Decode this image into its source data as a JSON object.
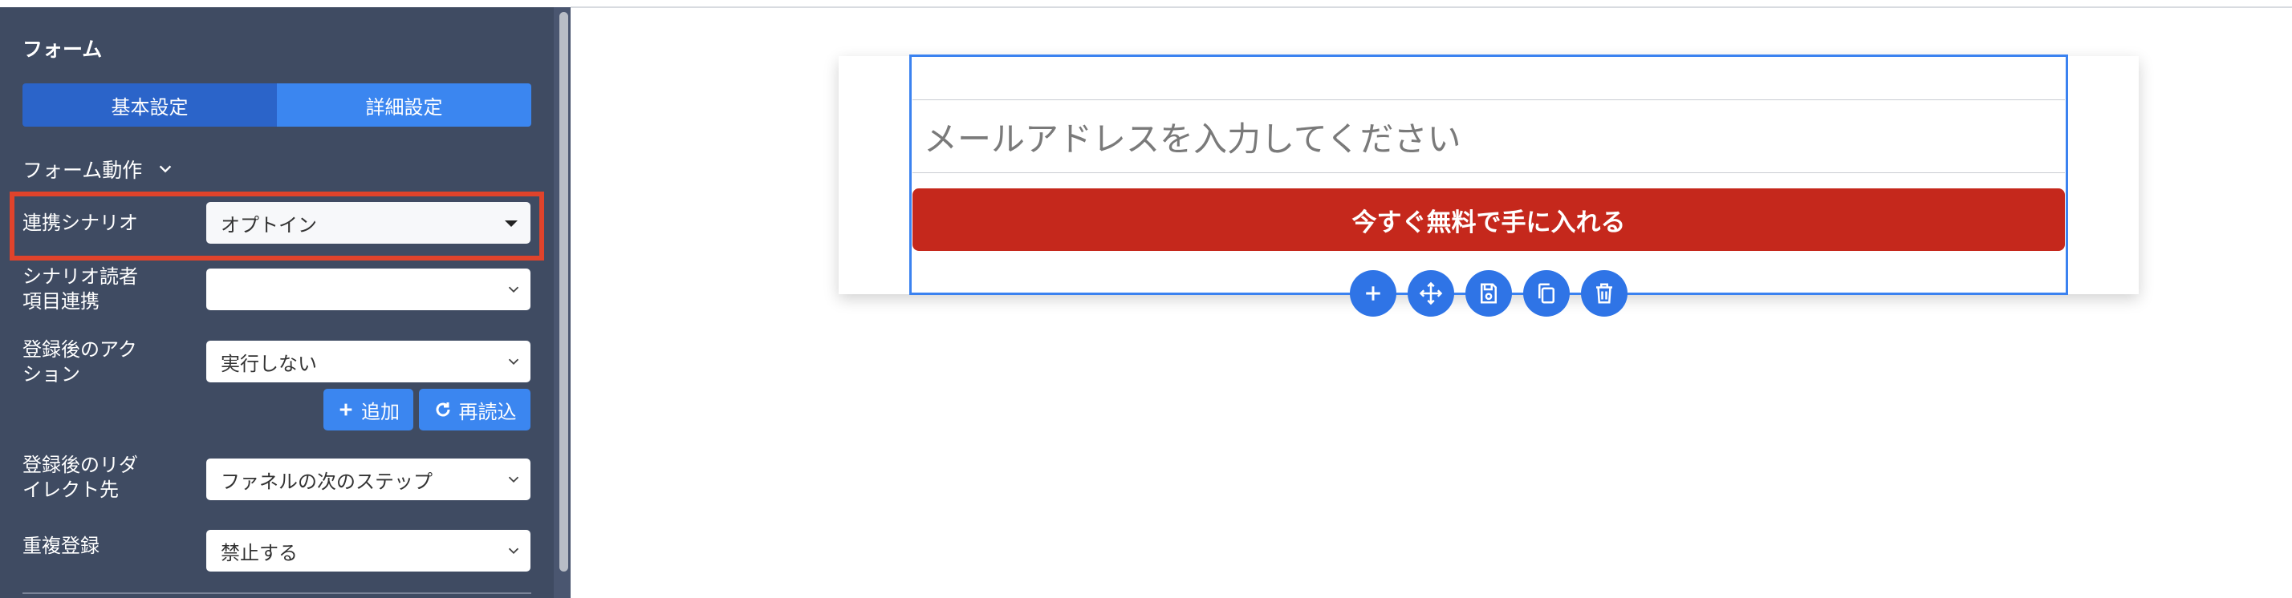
{
  "sidebar": {
    "title": "フォーム",
    "tabs": {
      "basic": "基本設定",
      "detail": "詳細設定"
    },
    "section": "フォーム動作",
    "scenario": {
      "label": "連携シナリオ",
      "value": "オプトイン"
    },
    "reader_fields": {
      "label_line1": "シナリオ読者",
      "label_line2": "項目連携",
      "value": ""
    },
    "post_action": {
      "label_line1": "登録後のアク",
      "label_line2": "ション",
      "value": "実行しない"
    },
    "add_button": "追加",
    "reload_button": "再読込",
    "redirect": {
      "label_line1": "登録後のリダ",
      "label_line2": "イレクト先",
      "value": "ファネルの次のステップ"
    },
    "duplicate": {
      "label": "重複登録",
      "value": "禁止する"
    }
  },
  "canvas": {
    "email_placeholder": "メールアドレスを入力してください",
    "cta_label": "今すぐ無料で手に入れる"
  },
  "colors": {
    "sidebar_bg": "#3f4b62",
    "accent_blue": "#3b86f0",
    "cta_red": "#c5281c",
    "highlight_red": "#e0432b"
  },
  "icons": [
    "plus-icon",
    "move-icon",
    "save-icon",
    "copy-icon",
    "trash-icon"
  ]
}
